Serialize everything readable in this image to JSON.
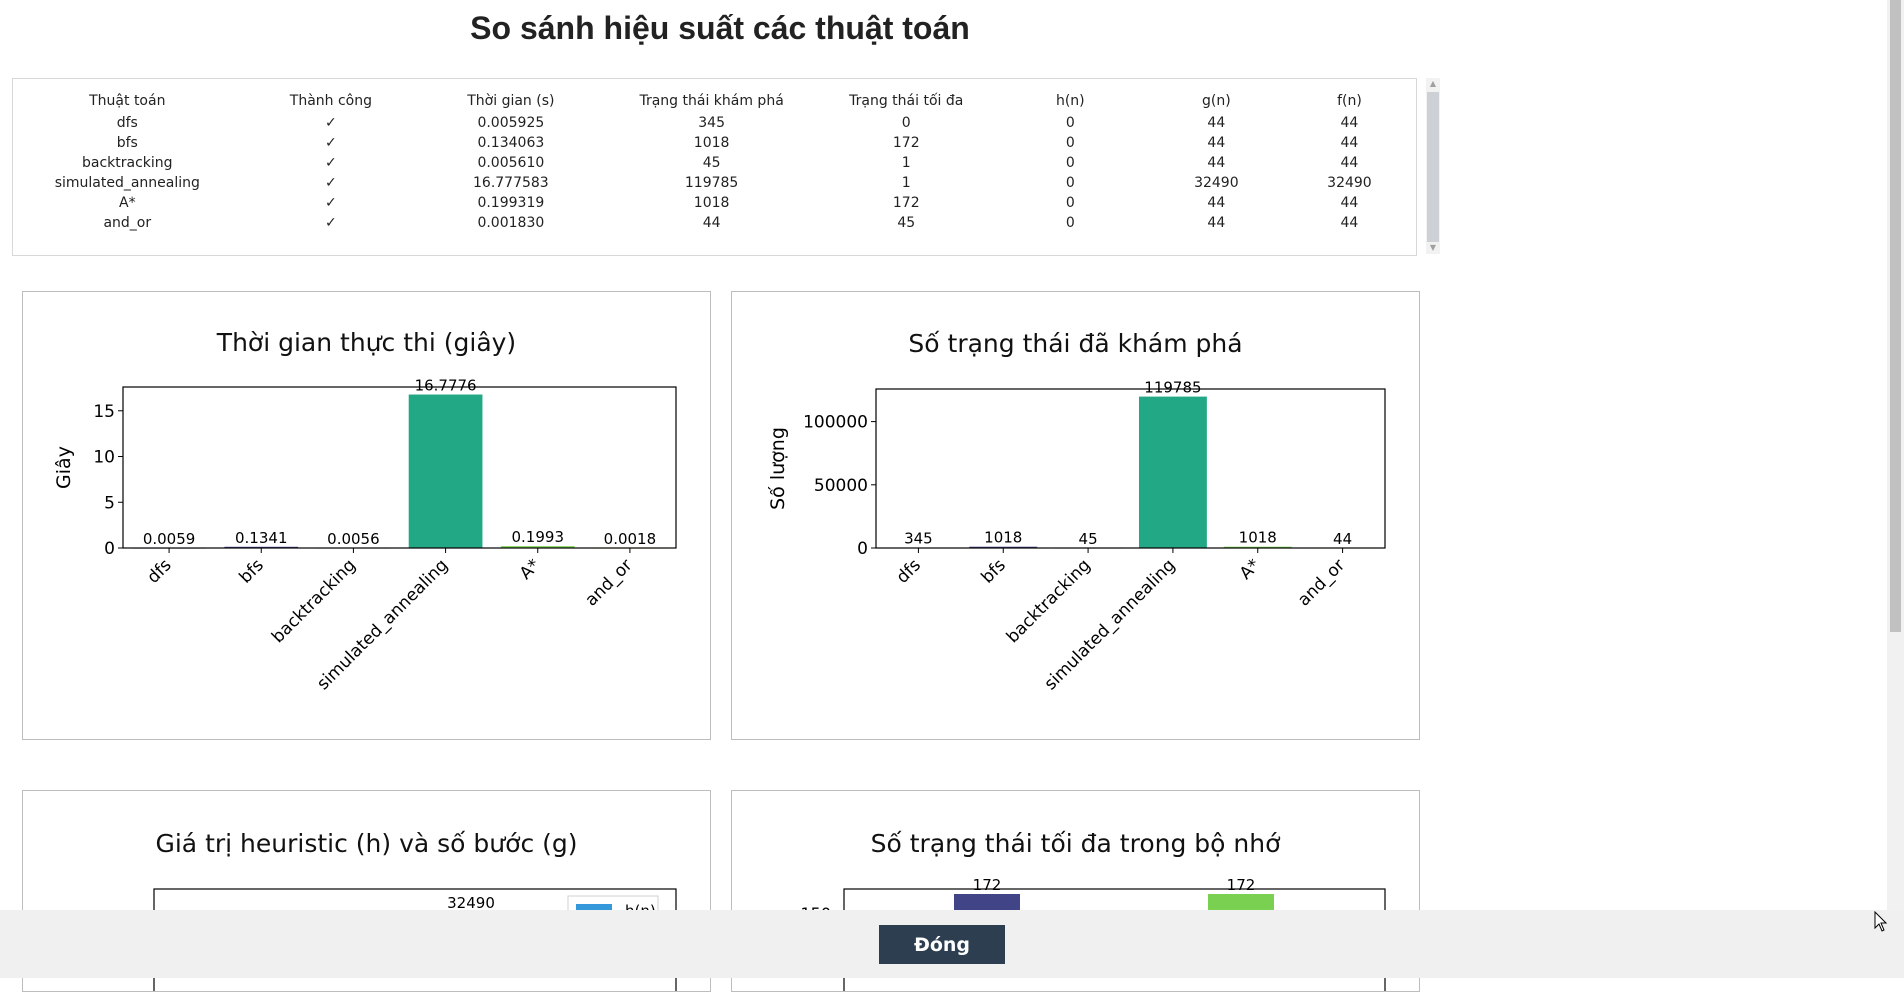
{
  "page_title": "So sánh hiệu suất các thuật toán",
  "table": {
    "headers": [
      "Thuật toán",
      "Thành công",
      "Thời gian (s)",
      "Trạng thái khám phá",
      "Trạng thái tối đa",
      "h(n)",
      "g(n)",
      "f(n)"
    ],
    "rows": [
      [
        "dfs",
        "✓",
        "0.005925",
        "345",
        "0",
        "0",
        "44",
        "44"
      ],
      [
        "bfs",
        "✓",
        "0.134063",
        "1018",
        "172",
        "0",
        "44",
        "44"
      ],
      [
        "backtracking",
        "✓",
        "0.005610",
        "45",
        "1",
        "0",
        "44",
        "44"
      ],
      [
        "simulated_annealing",
        "✓",
        "16.777583",
        "119785",
        "1",
        "0",
        "32490",
        "32490"
      ],
      [
        "A*",
        "✓",
        "0.199319",
        "1018",
        "172",
        "0",
        "44",
        "44"
      ],
      [
        "and_or",
        "✓",
        "0.001830",
        "44",
        "45",
        "0",
        "44",
        "44"
      ]
    ]
  },
  "chart_data": [
    {
      "type": "bar",
      "title": "Thời gian thực thi (giây)",
      "xlabel": "",
      "ylabel": "Giây",
      "categories": [
        "dfs",
        "bfs",
        "backtracking",
        "simulated_annealing",
        "A*",
        "and_or"
      ],
      "values": [
        0.0059,
        0.1341,
        0.0056,
        16.7776,
        0.1993,
        0.0018
      ],
      "value_labels": [
        "0.0059",
        "0.1341",
        "0.0056",
        "16.7776",
        "0.1993",
        "0.0018"
      ],
      "ylim": [
        0,
        17.6
      ],
      "yticks": [
        0,
        5,
        10,
        15
      ],
      "colors": [
        "#440154",
        "#414487",
        "#2a788e",
        "#22a884",
        "#7ad151",
        "#fde725"
      ]
    },
    {
      "type": "bar",
      "title": "Số trạng thái đã khám phá",
      "xlabel": "",
      "ylabel": "Số lượng",
      "categories": [
        "dfs",
        "bfs",
        "backtracking",
        "simulated_annealing",
        "A*",
        "and_or"
      ],
      "values": [
        345,
        1018,
        45,
        119785,
        1018,
        44
      ],
      "value_labels": [
        "345",
        "1018",
        "45",
        "119785",
        "1018",
        "44"
      ],
      "ylim": [
        0,
        125800
      ],
      "yticks": [
        0,
        50000,
        100000
      ],
      "colors": [
        "#440154",
        "#414487",
        "#2a788e",
        "#22a884",
        "#7ad151",
        "#fde725"
      ]
    },
    {
      "type": "bar",
      "title": "Giá trị heuristic (h) và số bước (g)",
      "visible_labels": [
        "32490"
      ],
      "legend": [
        "h(n)"
      ],
      "legend_position": "top-right",
      "colors": [
        "#3498db"
      ]
    },
    {
      "type": "bar",
      "title": "Số trạng thái tối đa trong bộ nhớ",
      "visible_labels": [
        "172",
        "172"
      ],
      "visible_ytick": "150",
      "colors": [
        "#414487",
        "#7ad151"
      ]
    }
  ],
  "close_label": "Đóng"
}
